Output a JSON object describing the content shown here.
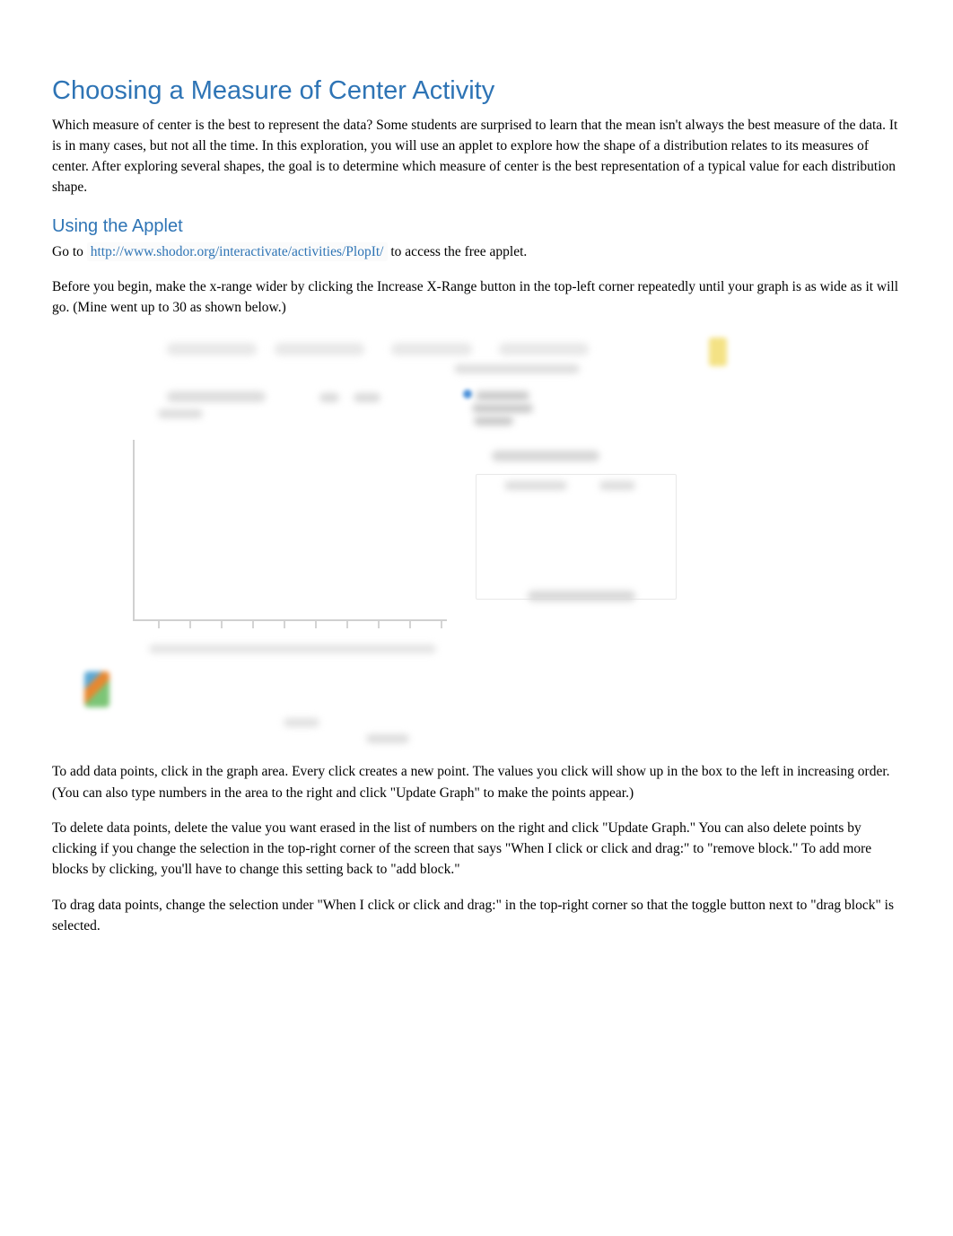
{
  "title": "Choosing a Measure of Center Activity",
  "intro": "Which measure of center is the best to represent the data? Some students are surprised to learn that the mean isn't always the best measure of the data. It is in many cases, but not all the time. In this exploration, you will use an applet to explore how the shape of a distribution relates to its measures of center. After exploring several shapes, the goal is to determine which measure of center is the best representation of a typical value for each distribution shape.",
  "section1": {
    "heading": "Using the Applet",
    "goto_prefix": "Go to ",
    "link_text": "http://www.shodor.org/interactivate/activities/PlopIt/",
    "goto_suffix": " to access the free applet.",
    "before_begin": "Before you begin, make the x-range wider by clicking the Increase X-Range button in the top-left corner repeatedly until your graph is as wide as it will go. (Mine went up to 30 as shown below.)"
  },
  "instructions": {
    "add_lead": "To add data points,",
    "add_rest": "  click in the graph area. Every click creates a new point. The values you click will show up in the box to the left in increasing order. (You can also type numbers in the area to the right and click \"Update Graph\" to make the points appear.)",
    "delete_lead": "To delete data points,",
    "delete_rest": "  delete the value you want erased in the list of numbers on the right and click \"Update Graph.\" You can also delete points by clicking if you change the selection in the top-right corner of the screen that says \"When I click or click and drag:\" to \"remove block.\" To add more blocks by clicking, you'll have to change this setting back to \"add block.\"",
    "drag_lead": "To drag data points,",
    "drag_rest": "  change the selection under \"When I click or click and drag:\" in the top-right corner so that the toggle button next to \"drag block\" is selected."
  }
}
